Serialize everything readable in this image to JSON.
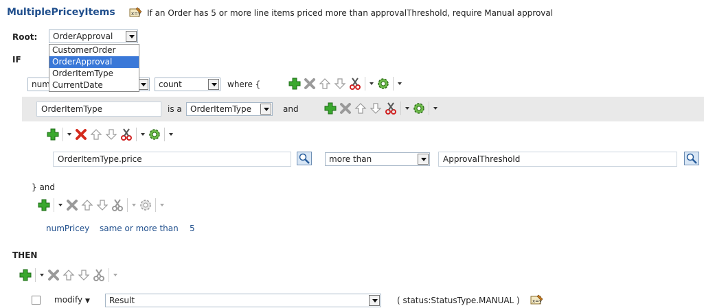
{
  "rule": {
    "name": "MultiplePriceyItems",
    "description": "If an Order has 5 or more line items priced more than approvalThreshold, require Manual approval"
  },
  "root": {
    "label": "Root:",
    "selected": "OrderApproval",
    "options": [
      "CustomerOrder",
      "OrderApproval",
      "OrderItemType",
      "CurrentDate"
    ]
  },
  "if_label": "IF",
  "then_label": "THEN",
  "aggregate": {
    "var_partial": "num",
    "function": "count",
    "where_text": "where {"
  },
  "pattern": {
    "variable": "OrderItemType",
    "is_a": "is a",
    "type": "OrderItemType",
    "and_text": "and"
  },
  "condition": {
    "left": "OrderItemType.price",
    "operator": "more than",
    "right": "ApprovalThreshold"
  },
  "close_text": "}  and",
  "test": {
    "variable": "numPricey",
    "operator": "same or more than",
    "value": "5"
  },
  "action": {
    "verb": "modify",
    "target": "Result",
    "params": "( status:StatusType.MANUAL )"
  },
  "icons": [
    "expression-builder-icon",
    "add-icon",
    "delete-icon",
    "move-up-icon",
    "move-down-icon",
    "cut-icon",
    "settings-gear-icon",
    "search-icon"
  ]
}
